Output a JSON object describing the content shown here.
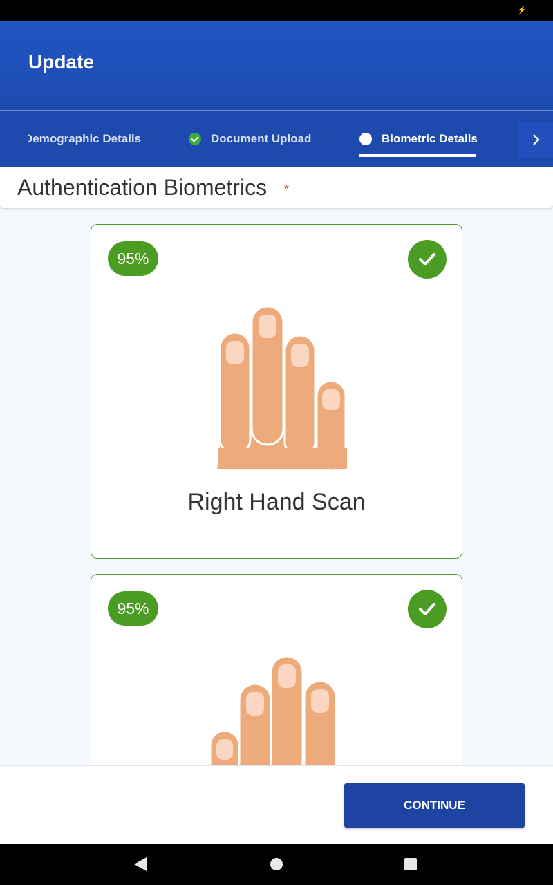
{
  "app": {
    "title": "Update"
  },
  "status_bar": {
    "battery_icon": "battery-charging-icon"
  },
  "tabs": [
    {
      "label": "Demographic Details",
      "state": "completed"
    },
    {
      "label": "Document Upload",
      "state": "completed",
      "icon": "check-circle-icon"
    },
    {
      "label": "Biometric Details",
      "state": "active",
      "icon": "dot-icon"
    }
  ],
  "tabs_next_icon": "chevron-right-icon",
  "section": {
    "title": "Authentication Biometrics",
    "required_marker": "*"
  },
  "cards": [
    {
      "quality": "95%",
      "status_icon": "check-icon",
      "label": "Right Hand Scan",
      "image": "right-hand-icon"
    },
    {
      "quality": "95%",
      "status_icon": "check-icon",
      "label": "",
      "image": "left-hand-icon"
    }
  ],
  "footer": {
    "continue_label": "CONTINUE"
  },
  "nav": {
    "back_icon": "back-icon",
    "home_icon": "home-icon",
    "recents_icon": "recents-icon"
  },
  "colors": {
    "header": "#1d4bb0",
    "success": "#4a9c22",
    "button": "#1d43a3",
    "required": "#e54a4a"
  }
}
